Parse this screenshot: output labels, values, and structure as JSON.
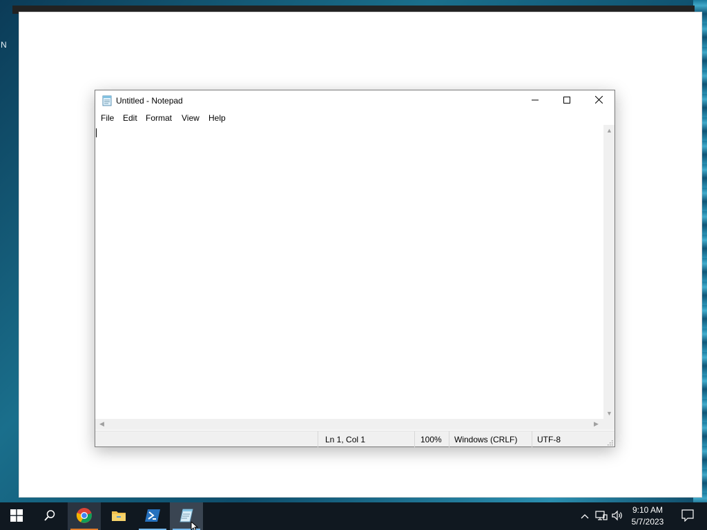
{
  "desktop": {
    "label": "N"
  },
  "notepad": {
    "title": "Untitled - Notepad",
    "menu": [
      "File",
      "Edit",
      "Format",
      "View",
      "Help"
    ],
    "content": "",
    "status": {
      "position": "Ln 1, Col 1",
      "zoom": "100%",
      "line_endings": "Windows (CRLF)",
      "encoding": "UTF-8"
    },
    "icons": {
      "app": "notepad-icon",
      "minimize": "minimize-icon",
      "maximize": "maximize-icon",
      "close": "close-icon"
    }
  },
  "taskbar": {
    "apps": [
      {
        "name": "start",
        "icon": "windows-logo-icon"
      },
      {
        "name": "search",
        "icon": "search-icon"
      },
      {
        "name": "chrome",
        "icon": "chrome-icon"
      },
      {
        "name": "file-explorer",
        "icon": "folder-icon"
      },
      {
        "name": "powershell",
        "icon": "powershell-icon"
      },
      {
        "name": "notepad",
        "icon": "notepad-icon"
      }
    ],
    "tray": {
      "icons": [
        "chevron-up-icon",
        "network-icon",
        "volume-icon"
      ],
      "time": "9:10 AM",
      "date": "5/7/2023",
      "notification_icon": "notification-icon"
    }
  },
  "colors": {
    "taskbar": "#101820",
    "accent_underline": "#76b9ed",
    "chrome_underline": "#e07b2a"
  }
}
